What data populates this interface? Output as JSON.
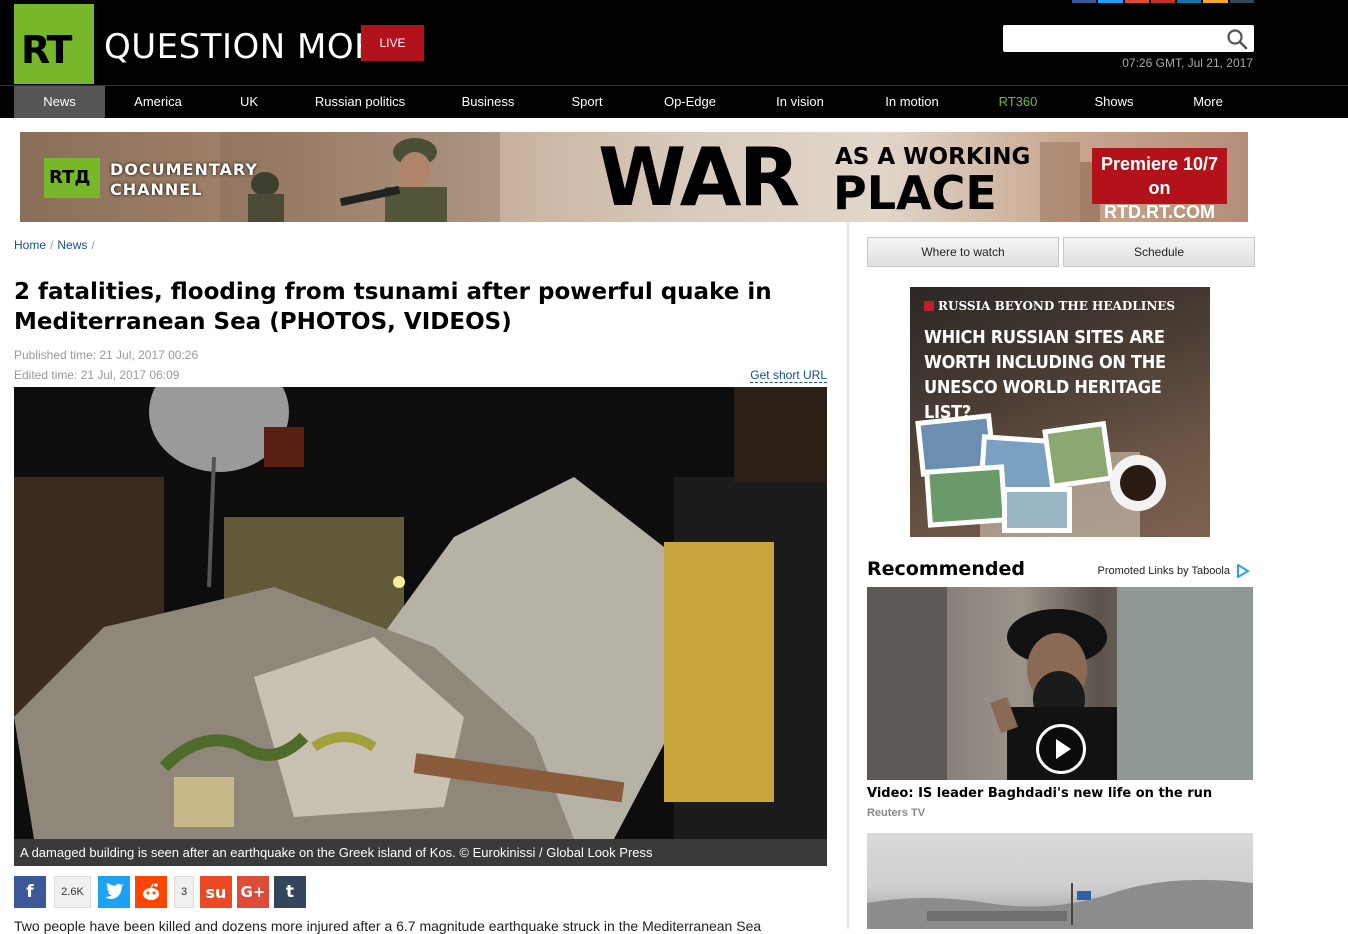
{
  "header": {
    "logo_text": "RT",
    "tagline": "QUESTION MORE",
    "live_label": "LIVE",
    "search": {
      "value": "",
      "placeholder": ""
    },
    "datetime": "07:26 GMT, Jul 21, 2017"
  },
  "nav": [
    {
      "label": "News"
    },
    {
      "label": "America"
    },
    {
      "label": "UK"
    },
    {
      "label": "Russian politics"
    },
    {
      "label": "Business"
    },
    {
      "label": "Sport"
    },
    {
      "label": "Op-Edge"
    },
    {
      "label": "In vision"
    },
    {
      "label": "In motion"
    },
    {
      "label": "RT360"
    },
    {
      "label": "Shows"
    },
    {
      "label": "More"
    }
  ],
  "banner": {
    "badge": "RTД",
    "channel_line1": "DOCUMENTARY",
    "channel_line2": "CHANNEL",
    "war": "WAR",
    "as_a_working": "AS A WORKING",
    "place": "PLACE",
    "premiere_line1": "Premiere 10/7",
    "premiere_line2": "on RTD.RT.COM"
  },
  "breadcrumb": {
    "home": "Home",
    "news": "News"
  },
  "article": {
    "headline": "2 fatalities, flooding from tsunami after powerful quake in Mediterranean Sea (PHOTOS, VIDEOS)",
    "published": "Published time: 21 Jul, 2017 00:26",
    "edited": "Edited time: 21 Jul, 2017 06:09",
    "short_url": "Get short URL",
    "caption": "A damaged building is seen after an earthquake on the Greek island of Kos. © Eurokinissi / Global Look Press",
    "share_counts": {
      "facebook": "2.6K",
      "reddit": "3"
    },
    "lead": "Two people have been killed and dozens more injured after a 6.7 magnitude earthquake struck in the Mediterranean Sea"
  },
  "sidebar": {
    "where_to_watch": "Where to watch",
    "schedule": "Schedule",
    "ad": {
      "brand": "RUSSIA BEYOND THE HEADLINES",
      "question": "WHICH RUSSIAN SITES ARE WORTH INCLUDING ON THE UNESCO WORLD HERITAGE LIST?"
    },
    "recommended_title": "Recommended",
    "promoted": "Promoted Links by Taboola",
    "rec1": {
      "title": "Video: IS leader Baghdadi's new life on the run",
      "source": "Reuters TV"
    }
  },
  "colors": {
    "brand_green": "#77b82a",
    "live_red": "#b3121b",
    "link_blue": "#1b4f8a",
    "facebook": "#3b5998",
    "twitter": "#1da1f2",
    "reddit": "#ff4500",
    "stumbleupon": "#eb4924",
    "googleplus": "#dd4b39",
    "tumblr": "#35465c"
  }
}
